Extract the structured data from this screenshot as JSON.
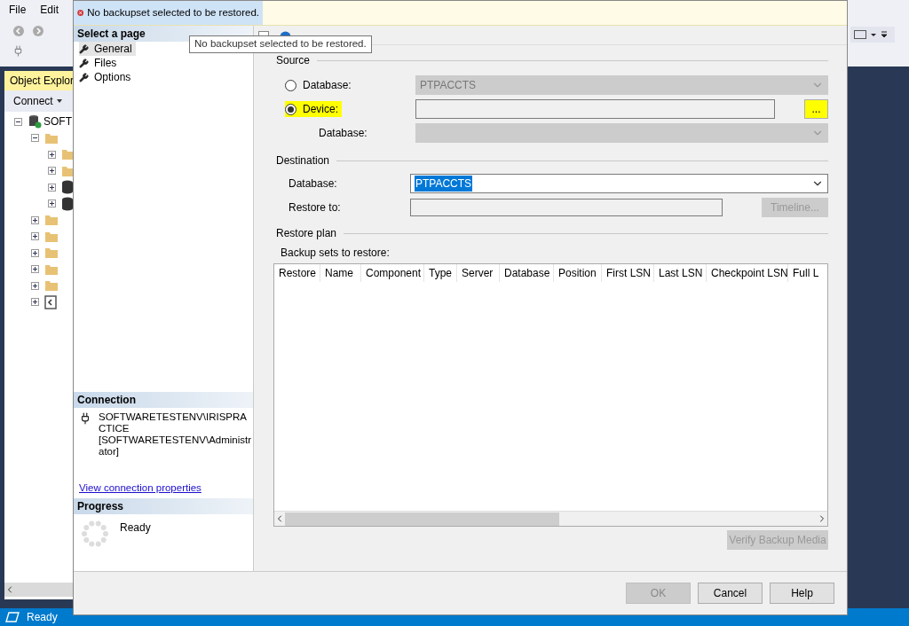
{
  "app": {
    "menu": [
      "File",
      "Edit"
    ],
    "object_explorer": {
      "title": "Object Explor",
      "connect": "Connect",
      "tree": [
        {
          "label": "SOFT",
          "kind": "server",
          "expanded": true,
          "children": [
            {
              "kind": "folder",
              "expanded": true,
              "children": [
                {
                  "kind": "folder",
                  "expanded": false
                },
                {
                  "kind": "folder",
                  "expanded": false
                },
                {
                  "kind": "database",
                  "expanded": false
                },
                {
                  "kind": "database",
                  "expanded": false
                }
              ]
            },
            {
              "kind": "folder",
              "expanded": false
            },
            {
              "kind": "folder",
              "expanded": false
            },
            {
              "kind": "folder",
              "expanded": false
            },
            {
              "kind": "folder",
              "expanded": false
            },
            {
              "kind": "folder",
              "expanded": false
            },
            {
              "kind": "catalog",
              "expanded": false
            }
          ]
        }
      ]
    },
    "status": "Ready"
  },
  "dialog": {
    "error": "No backupset selected to be restored.",
    "tooltip": "No backupset selected to be restored.",
    "select_page": "Select a page",
    "pages": [
      {
        "label": "General",
        "selected": true
      },
      {
        "label": "Files",
        "selected": false
      },
      {
        "label": "Options",
        "selected": false
      }
    ],
    "connection": {
      "title": "Connection",
      "lines": [
        "SOFTWARETESTENV\\IRISPRA",
        "CTICE",
        "[SOFTWARETESTENV\\Administr",
        "ator]"
      ],
      "link": "View connection properties"
    },
    "progress": {
      "title": "Progress",
      "status": "Ready"
    },
    "source": {
      "title": "Source",
      "options": [
        {
          "label": "Database:",
          "selected": false,
          "highlighted": false,
          "value": "PTPACCTS"
        },
        {
          "label": "Device:",
          "selected": true,
          "highlighted": true
        }
      ],
      "database_label": "Database:",
      "browse_button": {
        "label": "...",
        "highlighted": true
      }
    },
    "destination": {
      "title": "Destination",
      "database_label": "Database:",
      "database_value": "PTPACCTS",
      "restore_to_label": "Restore to:",
      "timeline_button": {
        "label": "Timeline...",
        "disabled": true
      }
    },
    "restore_plan": {
      "title": "Restore plan",
      "backup_sets_label": "Backup sets to restore:",
      "columns": [
        "Restore",
        "Name",
        "Component",
        "Type",
        "Server",
        "Database",
        "Position",
        "First LSN",
        "Last LSN",
        "Checkpoint LSN",
        "Full L"
      ]
    },
    "verify_button": {
      "label": "Verify Backup Media",
      "disabled": true
    },
    "buttons": [
      {
        "label": "OK",
        "disabled": true
      },
      {
        "label": "Cancel",
        "disabled": false
      },
      {
        "label": "Help",
        "disabled": false
      }
    ]
  }
}
